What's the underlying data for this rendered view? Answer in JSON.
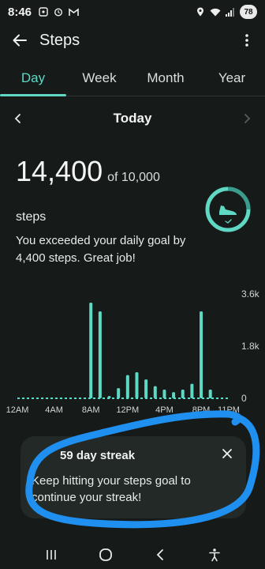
{
  "status": {
    "time": "8:46",
    "battery": "78"
  },
  "app_bar": {
    "title": "Steps"
  },
  "tabs": [
    {
      "label": "Day",
      "active": true
    },
    {
      "label": "Week",
      "active": false
    },
    {
      "label": "Month",
      "active": false
    },
    {
      "label": "Year",
      "active": false
    }
  ],
  "date_nav": {
    "label": "Today"
  },
  "summary": {
    "steps": "14,400",
    "goal_text": "of 10,000",
    "unit": "steps",
    "message": "You exceeded your daily goal by 4,400 steps. Great job!",
    "goal_progress": 1.44
  },
  "streak_card": {
    "title": "59 day streak",
    "body": "Keep hitting your steps goal to continue your streak!"
  },
  "chart_data": {
    "type": "bar",
    "x_ticks": [
      "12AM",
      "4AM",
      "8AM",
      "12PM",
      "4PM",
      "8PM",
      "11PM"
    ],
    "y_ticks": [
      "3.6k",
      "1.8k",
      "0"
    ],
    "ylim": [
      0,
      3600
    ],
    "hours": [
      0,
      1,
      2,
      3,
      4,
      5,
      6,
      7,
      8,
      9,
      10,
      11,
      12,
      13,
      14,
      15,
      16,
      17,
      18,
      19,
      20,
      21,
      22,
      23
    ],
    "values": [
      0,
      0,
      0,
      0,
      0,
      0,
      0,
      0,
      3300,
      3000,
      80,
      350,
      800,
      900,
      650,
      420,
      300,
      210,
      300,
      500,
      3000,
      300,
      0,
      0
    ],
    "accent": "#5fd8c4"
  },
  "colors": {
    "accent": "#5fd8c4",
    "background": "#161b1a",
    "scribble": "#1f8ff0"
  }
}
